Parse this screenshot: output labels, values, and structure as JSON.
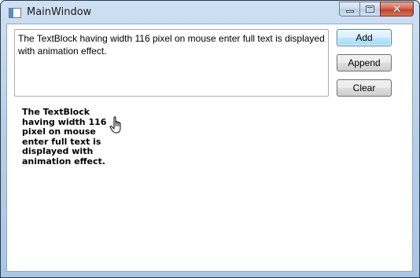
{
  "window": {
    "title": "MainWindow"
  },
  "caption_buttons": {
    "close_glyph": "✕"
  },
  "input": {
    "value": "The TextBlock having width 116 pixel on mouse enter full text is displayed with animation effect."
  },
  "buttons": {
    "add_label": "Add",
    "append_label": "Append",
    "clear_label": "Clear"
  },
  "textblock": {
    "text": "The TextBlock having width 116 pixel on mouse enter full text is displayed with animation effect."
  },
  "icons": {
    "app": "window-app-icon",
    "cursor": "hand-pointer-icon"
  }
}
